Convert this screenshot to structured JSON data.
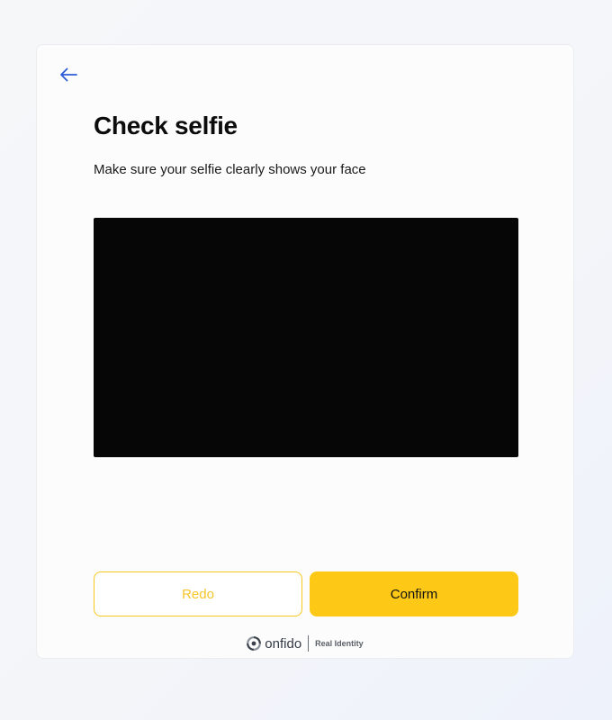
{
  "page": {
    "title": "Check selfie",
    "subtitle": "Make sure your selfie clearly shows your face"
  },
  "nav": {
    "back_icon": "arrow-left-icon"
  },
  "actions": {
    "redo_label": "Redo",
    "confirm_label": "Confirm"
  },
  "footer": {
    "logo_icon": "onfido-logo-icon",
    "brand": "onfido",
    "tagline": "Real Identity"
  },
  "colors": {
    "accent": "#fdc916",
    "back_arrow": "#2c5bd8",
    "preview_bg": "#060606"
  }
}
